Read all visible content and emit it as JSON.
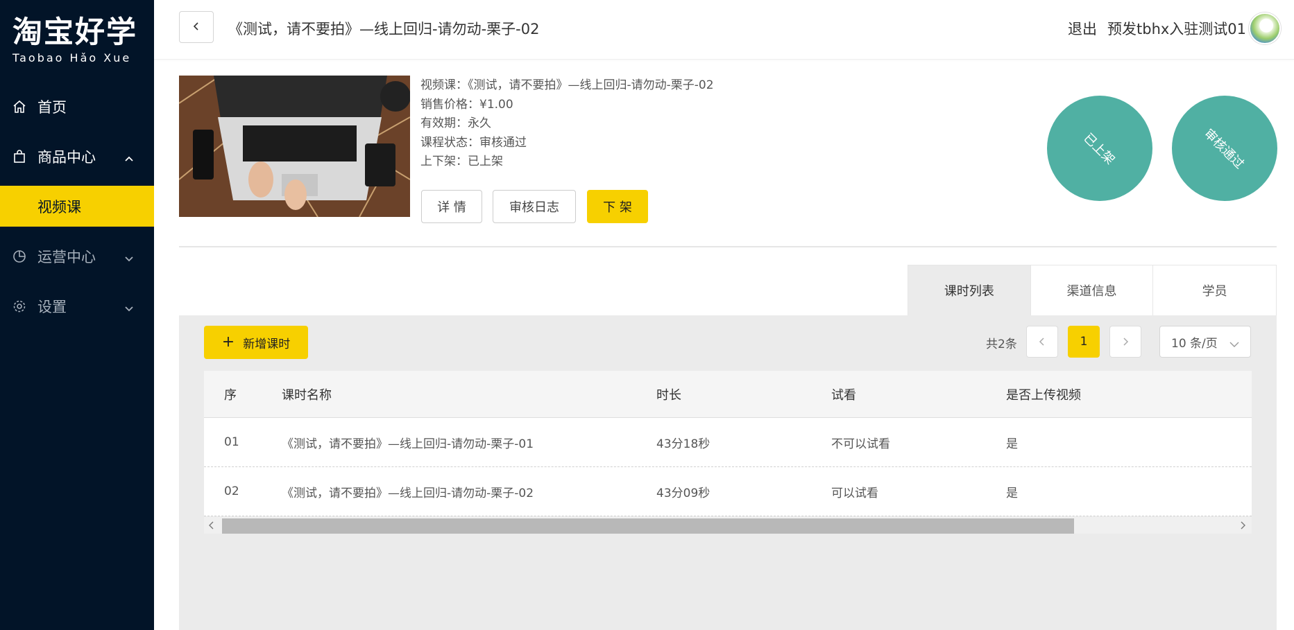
{
  "sidebar": {
    "logo_main": "淘宝好学",
    "logo_sub": "Taobao Hǎo Xue",
    "items": [
      {
        "label": "首页",
        "icon": "home-icon"
      },
      {
        "label": "商品中心",
        "icon": "bag-icon",
        "expanded": true
      },
      {
        "label": "运营中心",
        "icon": "pie-chart-icon"
      },
      {
        "label": "设置",
        "icon": "gear-icon"
      }
    ],
    "sub_item": "视频课"
  },
  "header": {
    "title": "《测试，请不要拍》—线上回归-请勿动-栗子-02",
    "logout": "退出",
    "username": "预发tbhx入驻测试01"
  },
  "course": {
    "line1": "视频课：《测试，请不要拍》—线上回归-请勿动-栗子-02",
    "line2": "销售价格：¥1.00",
    "line3": "有效期：永久",
    "line4": "课程状态：审核通过",
    "line5": "上下架：已上架",
    "btn_detail": "详 情",
    "btn_log": "审核日志",
    "btn_offshelf": "下 架",
    "stamp1": "已上架",
    "stamp2": "审核通过"
  },
  "tabs": [
    "课时列表",
    "渠道信息",
    "学员"
  ],
  "toolbar": {
    "add_label": "新增课时",
    "total": "共2条",
    "current_page": "1",
    "page_size": "10 条/页"
  },
  "table": {
    "headers": [
      "序",
      "课时名称",
      "时长",
      "试看",
      "是否上传视频"
    ],
    "rows": [
      [
        "01",
        "《测试，请不要拍》—线上回归-请勿动-栗子-01",
        "43分18秒",
        "不可以试看",
        "是"
      ],
      [
        "02",
        "《测试，请不要拍》—线上回归-请勿动-栗子-02",
        "43分09秒",
        "可以试看",
        "是"
      ]
    ]
  },
  "colors": {
    "sidebar_bg": "#021428",
    "accent": "#f7d000",
    "stamp": "#50b0a3"
  }
}
